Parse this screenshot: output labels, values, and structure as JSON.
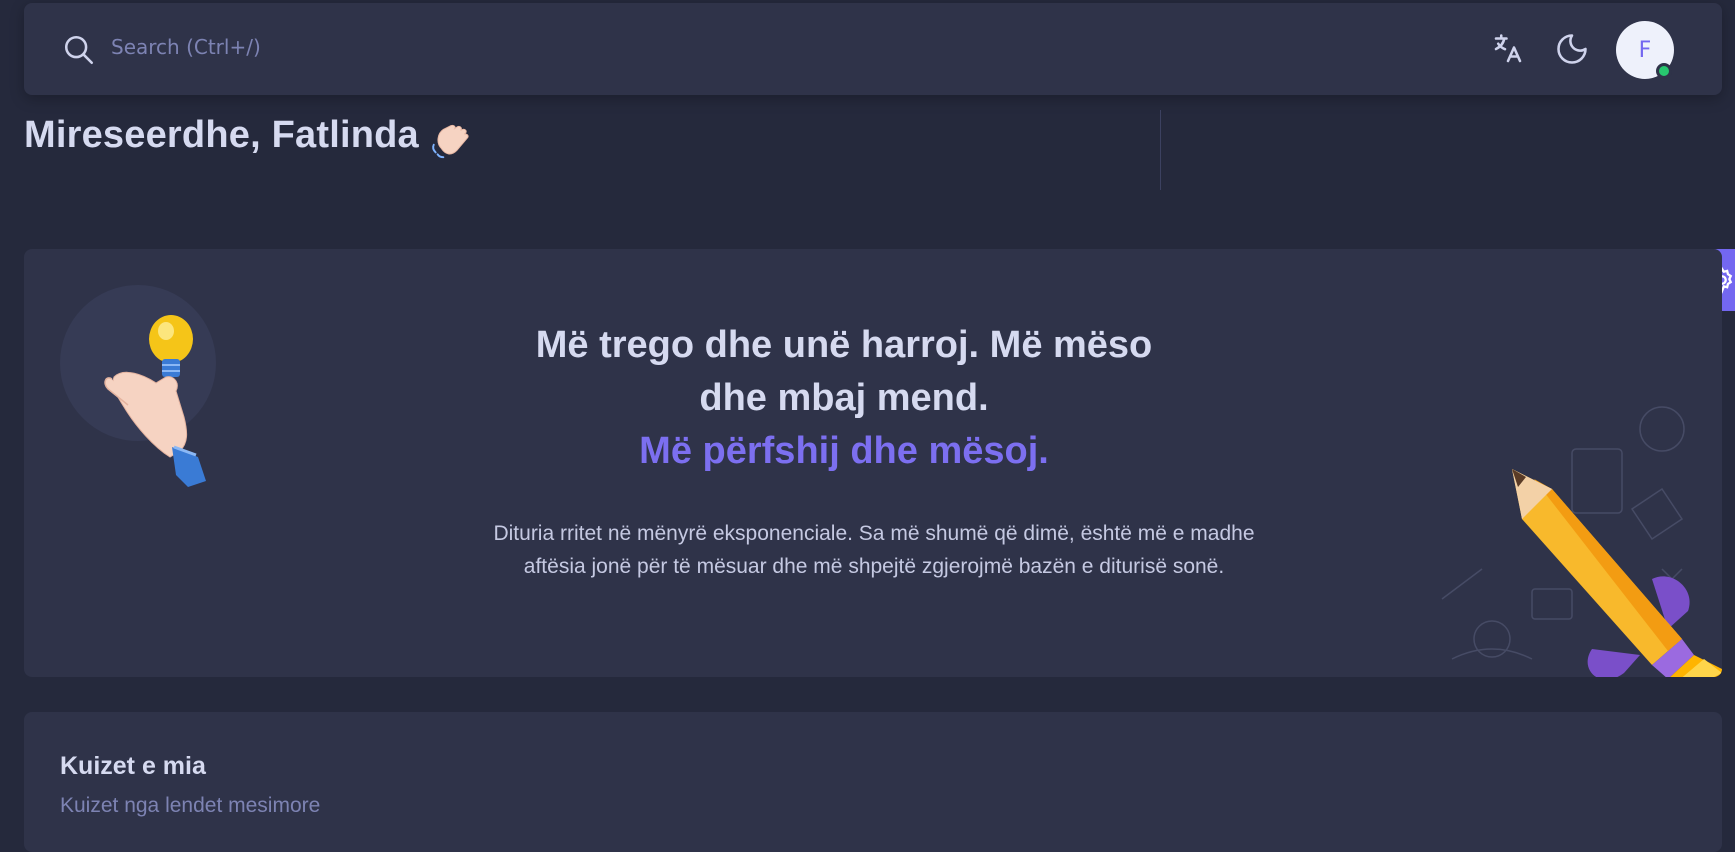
{
  "topbar": {
    "search_placeholder": "Search (Ctrl+/)",
    "avatar_initial": "F",
    "status_color": "#28c76f"
  },
  "welcome": {
    "text": "Mireseerdhe, Fatlinda"
  },
  "hero": {
    "title_line1": "Më trego dhe unë harroj. Më mëso",
    "title_line2": "dhe mbaj mend.",
    "title_accent": "Më përfshij dhe mësoj.",
    "description": "Dituria rritet në mënyrë eksponenciale. Sa më shumë që dimë, është më e madhe aftësia jonë për të mësuar dhe më shpejtë zgjerojmë bazën e diturisë sonë."
  },
  "quizzes": {
    "title": "Kuizet e mia",
    "subtitle": "Kuizet nga lendet mesimore"
  },
  "colors": {
    "background": "#25293c",
    "card": "#2f3349",
    "accent": "#7367f0"
  },
  "icons": {
    "search": "search-icon",
    "translate": "translate-icon",
    "theme": "moon-icon",
    "wave": "waving-hand-icon",
    "hero_left": "hand-lightbulb-illustration",
    "hero_right": "pencil-rocket-illustration",
    "settings": "gear-icon"
  }
}
